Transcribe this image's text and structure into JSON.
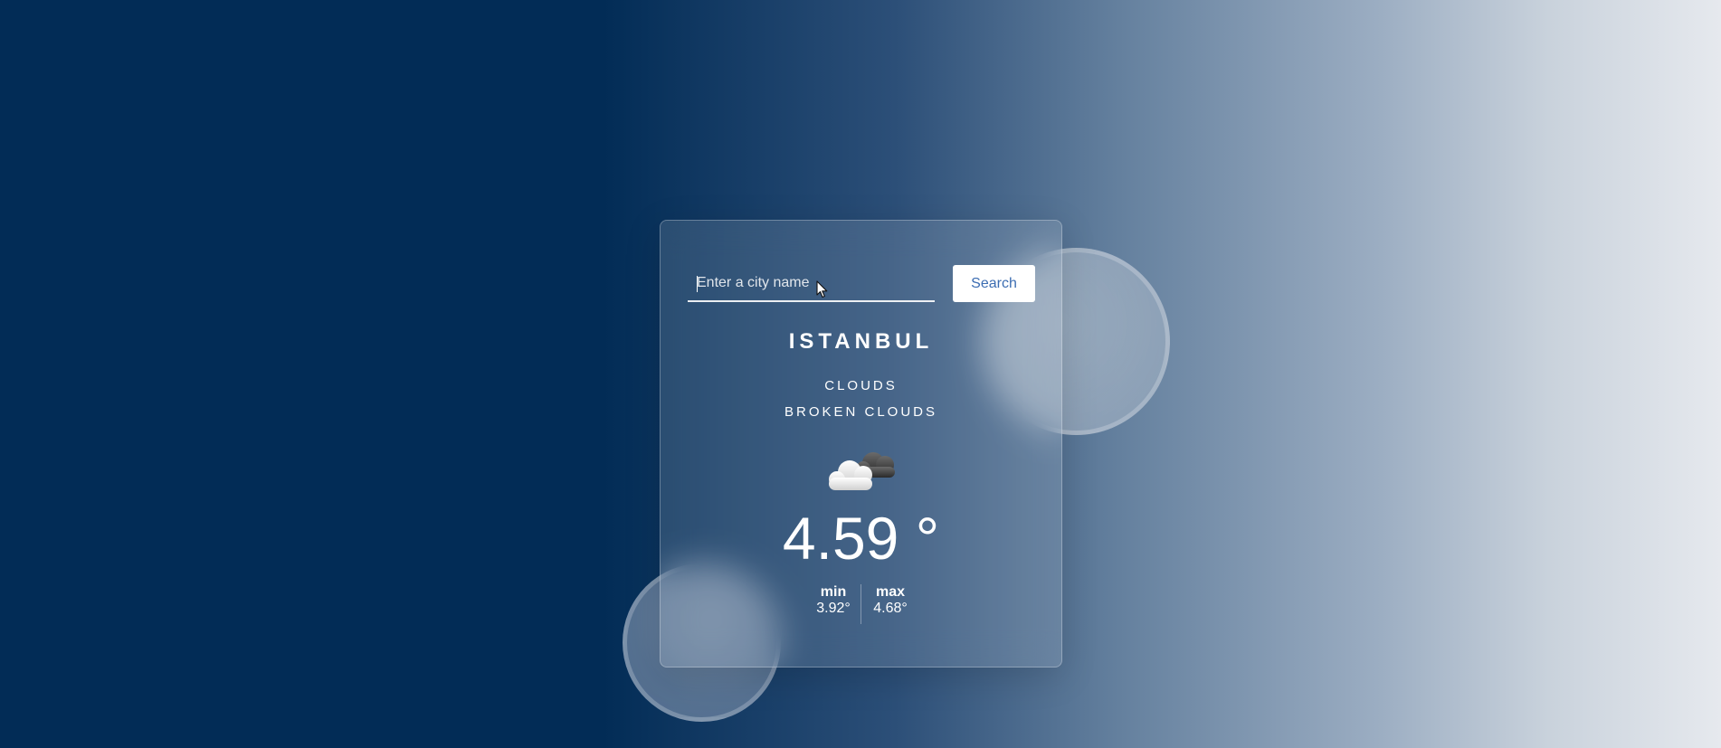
{
  "search": {
    "placeholder": "Enter a city name",
    "button_label": "Search"
  },
  "weather": {
    "city": "ISTANBUL",
    "main": "CLOUDS",
    "description": "BROKEN CLOUDS",
    "icon": "broken-clouds-icon",
    "temperature": "4.59 °",
    "min_label": "min",
    "min_value": "3.92°",
    "max_label": "max",
    "max_value": "4.68°"
  },
  "colors": {
    "background_dark": "#022c56",
    "background_light": "#e6e9ee",
    "button_text": "#3c6db2"
  }
}
